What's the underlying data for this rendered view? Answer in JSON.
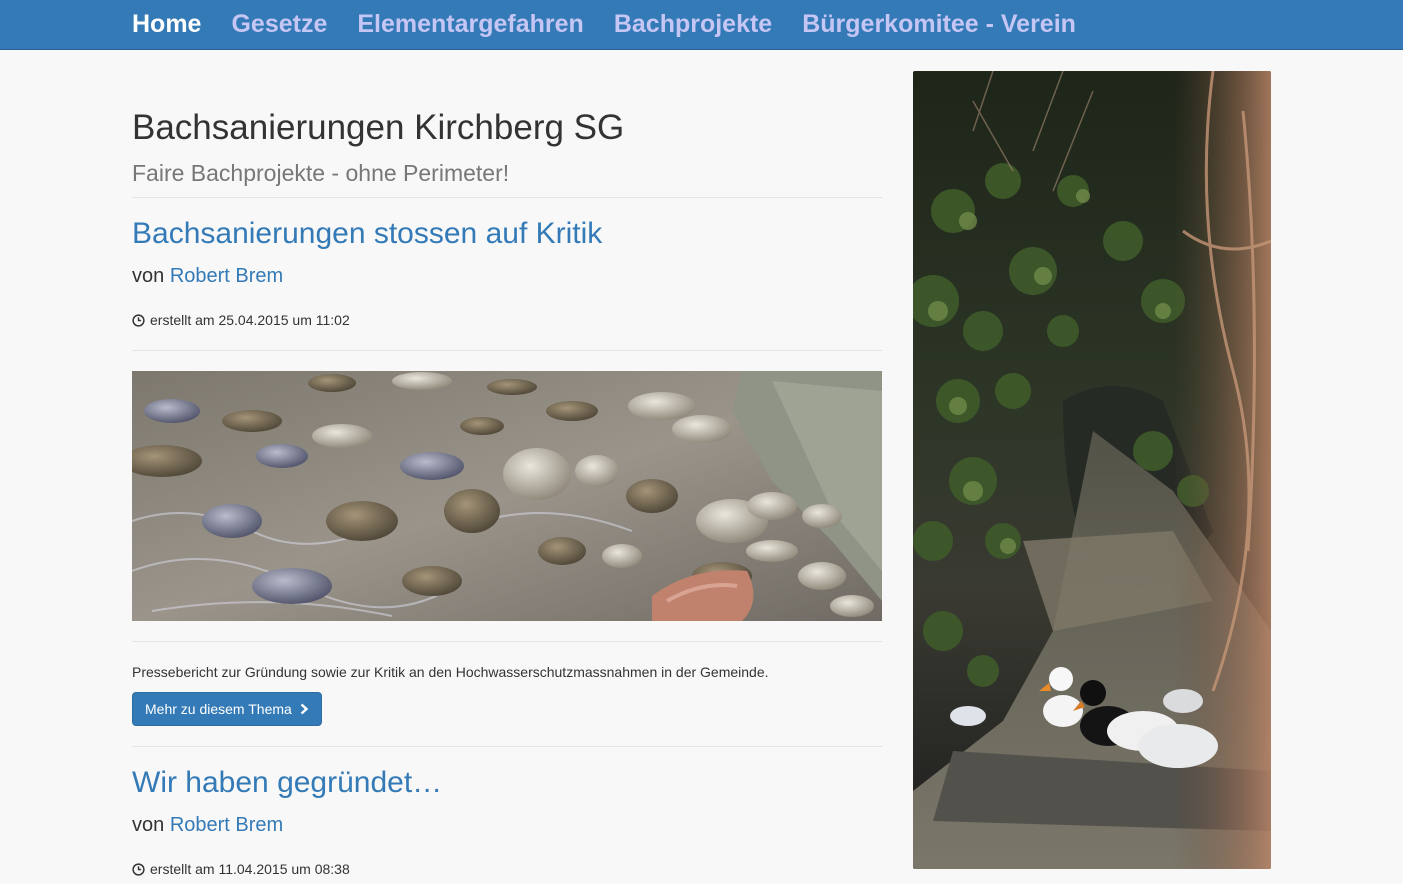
{
  "nav": {
    "items": [
      {
        "label": "Home",
        "active": true
      },
      {
        "label": "Gesetze",
        "active": false
      },
      {
        "label": "Elementargefahren",
        "active": false
      },
      {
        "label": "Bachprojekte",
        "active": false
      },
      {
        "label": "Bürgerkomitee - Verein",
        "active": false
      }
    ]
  },
  "site": {
    "title": "Bachsanierungen Kirchberg SG",
    "subtitle": "Faire Bachprojekte - ohne Perimeter!"
  },
  "posts": [
    {
      "title": "Bachsanierungen stossen auf Kritik",
      "by": "von",
      "author": "Robert Brem",
      "created": "erstellt am 25.04.2015 um 11:02",
      "excerpt": "Pressebericht zur Gründung sowie zur Kritik an den Hochwasserschutzmassnahmen in der Gemeinde.",
      "button_label": "Mehr zu diesem Thema"
    },
    {
      "title": "Wir haben gegründet…",
      "by": "von",
      "author": "Robert Brem",
      "created": "erstellt am 11.04.2015 um 08:38"
    }
  ],
  "colors": {
    "navbar": "#337ab7",
    "nav_inactive": "#c6c6f5",
    "link": "#337ab7",
    "background": "#f8f8f8"
  },
  "icons": [
    "clock-icon",
    "chevron-right-icon"
  ]
}
